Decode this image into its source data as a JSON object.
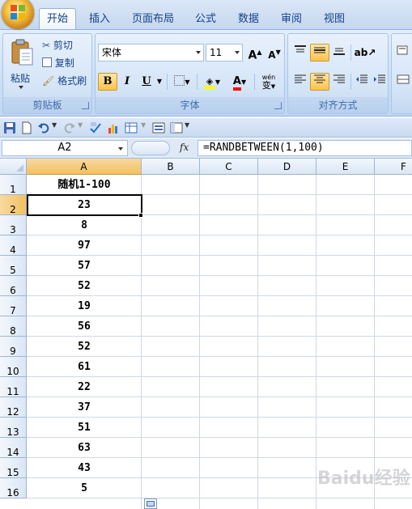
{
  "tabs": [
    "开始",
    "插入",
    "页面布局",
    "公式",
    "数据",
    "审阅",
    "视图"
  ],
  "clipboard": {
    "paste": "粘贴",
    "cut": "剪切",
    "copy": "复制",
    "format_painter": "格式刷",
    "group_label": "剪贴板"
  },
  "font": {
    "name": "宋体",
    "size": "11",
    "bold": "B",
    "italic": "I",
    "underline": "U",
    "grow": "A",
    "shrink": "A",
    "phonetic_top": "wén",
    "phonetic_char": "变",
    "group_label": "字体"
  },
  "alignment": {
    "group_label": "对齐方式"
  },
  "namebox": "A2",
  "fx": "fx",
  "formula": "=RANDBETWEEN(1,100)",
  "columns": [
    "A",
    "B",
    "C",
    "D",
    "E",
    "F"
  ],
  "rows": [
    "1",
    "2",
    "3",
    "4",
    "5",
    "6",
    "7",
    "8",
    "9",
    "10",
    "11",
    "12",
    "13",
    "14",
    "15",
    "16"
  ],
  "cells_a": [
    "随机1-100",
    "23",
    "8",
    "97",
    "57",
    "52",
    "19",
    "56",
    "52",
    "61",
    "22",
    "37",
    "51",
    "63",
    "43",
    "5"
  ],
  "colors": {
    "font_color": "#ff0000",
    "fill_color": "#ffff00",
    "accent": "#15428b"
  },
  "watermark": "Baidu经验"
}
